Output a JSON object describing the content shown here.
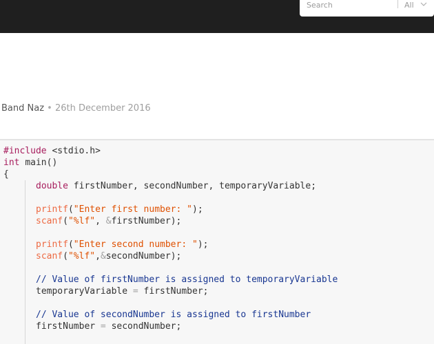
{
  "header": {
    "search": {
      "placeholder": "Search",
      "scope_label": "All"
    }
  },
  "post": {
    "author": "Band Naz",
    "separator": "•",
    "date": "26th December 2016"
  },
  "code": {
    "language": "c",
    "lines": [
      "#include <stdio.h>",
      "int main()",
      "{",
      "    double firstNumber, secondNumber, temporaryVariable;",
      "",
      "    printf(\"Enter first number: \");",
      "    scanf(\"%lf\", &firstNumber);",
      "",
      "    printf(\"Enter second number: \");",
      "    scanf(\"%lf\",&secondNumber);",
      "",
      "    // Value of firstNumber is assigned to temporaryVariable",
      "    temporaryVariable = firstNumber;",
      "",
      "    // Value of secondNumber is assigned to firstNumber",
      "    firstNumber = secondNumber;",
      ""
    ]
  },
  "colors": {
    "topbar": "#1f1f1f",
    "keyword": "#a71d5d",
    "function": "#ed6a43",
    "string": "#df5000",
    "comment": "#183691",
    "code_background": "#f7f7f7"
  },
  "icons": {
    "scope_chevron": "chevron-down-icon"
  }
}
